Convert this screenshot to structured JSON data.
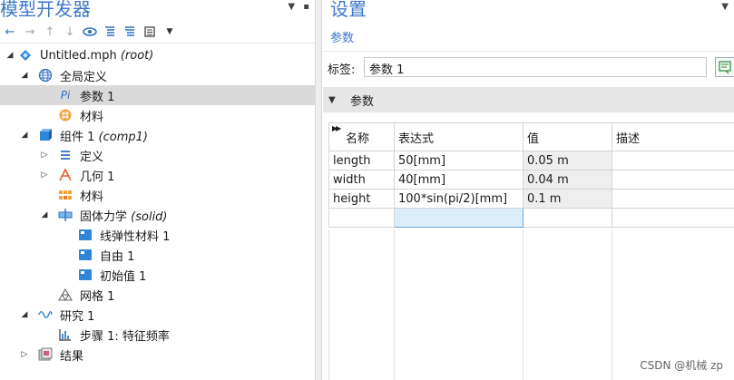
{
  "left": {
    "title": "模型开发器",
    "tree": [
      {
        "label": "Untitled.mph",
        "italic": "(root)"
      },
      {
        "label": "全局定义"
      },
      {
        "label": "参数 1"
      },
      {
        "label": "材料"
      },
      {
        "label": "组件 1",
        "italic": "(comp1)"
      },
      {
        "label": "定义"
      },
      {
        "label": "几何 1"
      },
      {
        "label": "材料"
      },
      {
        "label": "固体力学",
        "italic": "(solid)"
      },
      {
        "label": "线弹性材料 1"
      },
      {
        "label": "自由 1"
      },
      {
        "label": "初始值 1"
      },
      {
        "label": "网格 1"
      },
      {
        "label": "研究 1"
      },
      {
        "label": "步骤 1: 特征频率"
      },
      {
        "label": "结果"
      }
    ],
    "param_icon_text": "Pi"
  },
  "right": {
    "title": "设置",
    "subtitle": "参数",
    "label_caption": "标签:",
    "label_value": "参数 1",
    "section_title": "参数",
    "table": {
      "headers": [
        "名称",
        "表达式",
        "值",
        "描述"
      ],
      "rows": [
        [
          "length",
          "50[mm]",
          "0.05 m",
          ""
        ],
        [
          "width",
          "40[mm]",
          "0.04 m",
          ""
        ],
        [
          "height",
          "100*sin(pi/2)[mm]",
          "0.1 m",
          ""
        ],
        [
          "",
          "",
          "",
          ""
        ]
      ]
    }
  },
  "watermark": "CSDN @机械 zp",
  "colors": {
    "accent": "#3c78c8",
    "selected_row": "#dadada",
    "section_bg": "#e6e6e6",
    "active_cell": "#dcedfa"
  }
}
